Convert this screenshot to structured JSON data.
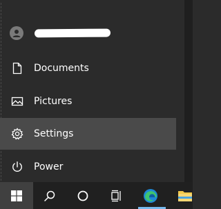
{
  "menu": {
    "items": [
      {
        "label": "Documents",
        "icon": "document-icon"
      },
      {
        "label": "Pictures",
        "icon": "pictures-icon"
      },
      {
        "label": "Settings",
        "icon": "gear-icon"
      },
      {
        "label": "Power",
        "icon": "power-icon"
      }
    ],
    "account": {
      "icon": "user-avatar-icon"
    }
  },
  "taskbar": {
    "buttons": [
      {
        "icon": "windows-start-icon"
      },
      {
        "icon": "search-icon"
      },
      {
        "icon": "cortana-icon"
      },
      {
        "icon": "task-view-icon"
      },
      {
        "icon": "edge-browser-icon"
      },
      {
        "icon": "file-explorer-icon"
      }
    ]
  },
  "colors": {
    "menu_bg": "#2b2b2b",
    "hover_bg": "#4a4a4a",
    "taskbar_bg": "#202020",
    "start_button_bg": "#404040",
    "accent": "#76b9ed"
  }
}
